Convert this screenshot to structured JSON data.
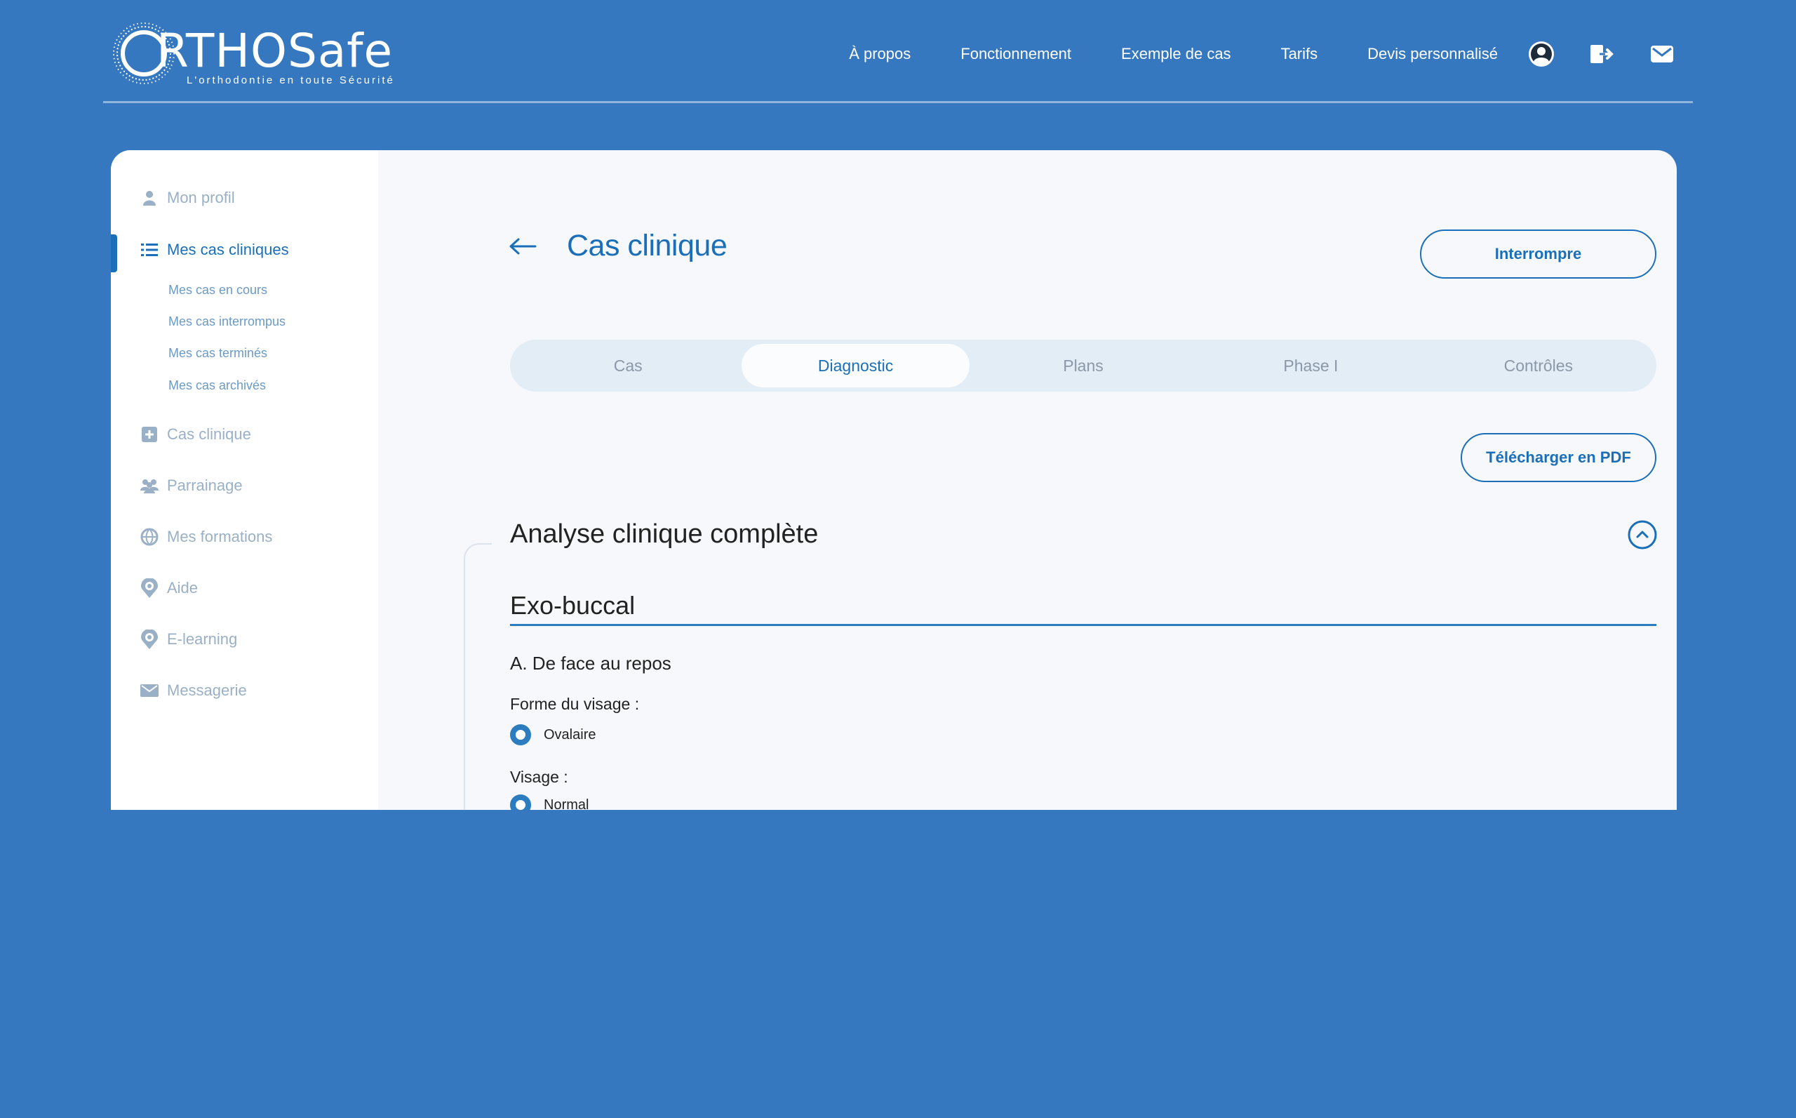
{
  "brand": {
    "name": "RTHOSafe",
    "tagline": "L'orthodontie en toute Sécurité"
  },
  "nav": {
    "links": [
      "À propos",
      "Fonctionnement",
      "Exemple de cas",
      "Tarifs",
      "Devis personnalisé"
    ],
    "icons": [
      "user-icon",
      "logout-icon",
      "mail-icon"
    ]
  },
  "sidebar": {
    "items": [
      {
        "label": "Mon profil",
        "icon": "user-icon"
      },
      {
        "label": "Mes cas cliniques",
        "icon": "list-icon"
      },
      {
        "label": "Cas clinique",
        "icon": "plus-square-icon"
      },
      {
        "label": "Parrainage",
        "icon": "group-icon"
      },
      {
        "label": "Mes formations",
        "icon": "globe-icon"
      },
      {
        "label": "Aide",
        "icon": "help-pin-icon"
      },
      {
        "label": "E-learning",
        "icon": "elearning-pin-icon"
      },
      {
        "label": "Messagerie",
        "icon": "envelope-icon"
      }
    ],
    "subitems": [
      "Mes cas en cours",
      "Mes cas interrompus",
      "Mes cas terminés",
      "Mes cas archivés"
    ]
  },
  "main": {
    "title": "Cas clinique",
    "interrupt_label": "Interrompre",
    "pdf_label": "Télécharger en PDF",
    "tabs": [
      "Cas",
      "Diagnostic",
      "Plans",
      "Phase I",
      "Contrôles"
    ],
    "active_tab": "Diagnostic",
    "section_title": "Analyse clinique complète",
    "subsection_title": "Exo-buccal",
    "group_title": "A. De face au repos",
    "fields": [
      {
        "label": "Forme du visage :",
        "value": "Ovalaire"
      },
      {
        "label": "Visage :",
        "value": "Normal"
      }
    ]
  },
  "colors": {
    "background": "#3578bf",
    "accent": "#1a6fb8",
    "card": "#f7f8fc"
  }
}
